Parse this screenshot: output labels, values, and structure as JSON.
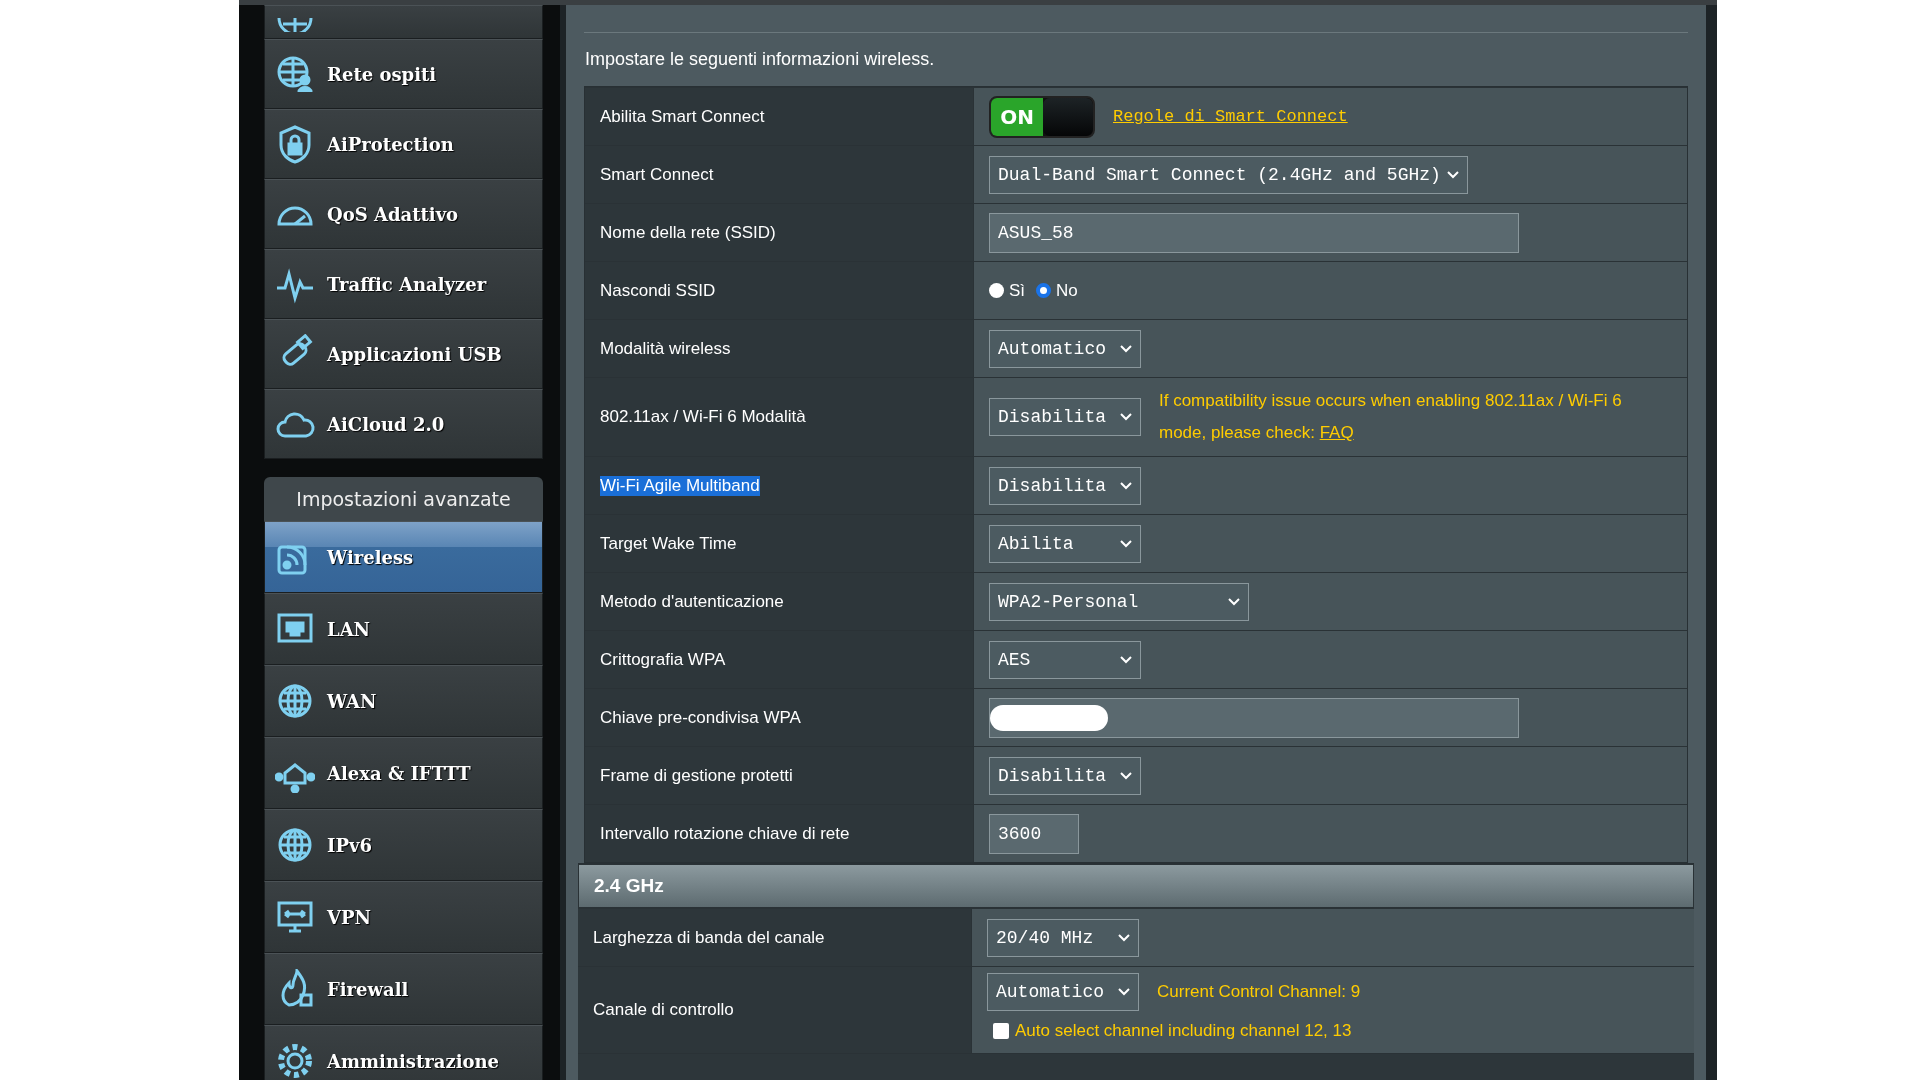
{
  "sidebar": {
    "items": [
      {
        "label": "Rete ospiti",
        "selected": false
      },
      {
        "label": "AiProtection",
        "selected": false
      },
      {
        "label": "QoS Adattivo",
        "selected": false
      },
      {
        "label": "Traffic Analyzer",
        "selected": false
      },
      {
        "label": "Applicazioni USB",
        "selected": false
      },
      {
        "label": "AiCloud 2.0",
        "selected": false
      }
    ],
    "advanced": {
      "title": "Impostazioni avanzate",
      "items": [
        {
          "label": "Wireless",
          "selected": true
        },
        {
          "label": "LAN",
          "selected": false
        },
        {
          "label": "WAN",
          "selected": false
        },
        {
          "label": "Alexa & IFTTT",
          "selected": false
        },
        {
          "label": "IPv6",
          "selected": false
        },
        {
          "label": "VPN",
          "selected": false
        },
        {
          "label": "Firewall",
          "selected": false
        },
        {
          "label": "Amministrazione",
          "selected": false
        }
      ]
    }
  },
  "main": {
    "intro": "Impostare le seguenti informazioni wireless.",
    "rows": [
      {
        "label": "Abilita Smart Connect",
        "kind": "toggle",
        "on": true,
        "toggle_text": "ON",
        "link": "Regole di Smart Connect"
      },
      {
        "label": "Smart Connect",
        "kind": "select",
        "value": "Dual-Band Smart Connect (2.4GHz and 5GHz)"
      },
      {
        "label": "Nome della rete (SSID)",
        "kind": "input",
        "value": "ASUS_58"
      },
      {
        "label": "Nascondi SSID",
        "kind": "radio",
        "options": [
          {
            "label": "Sì",
            "selected": false
          },
          {
            "label": "No",
            "selected": true
          }
        ]
      },
      {
        "label": "Modalità wireless",
        "kind": "select",
        "value": "Automatico"
      },
      {
        "label": "802.11ax / Wi-Fi 6 Modalità",
        "kind": "select",
        "value": "Disabilita",
        "note": "If compatibility issue occurs when enabling 802.11ax / Wi-Fi 6 mode, please check:",
        "note_link": "FAQ"
      },
      {
        "label": "Wi-Fi Agile Multiband",
        "kind": "select",
        "value": "Disabilita",
        "highlighted": true
      },
      {
        "label": "Target Wake Time",
        "kind": "select",
        "value": "Abilita"
      },
      {
        "label": "Metodo d'autenticazione",
        "kind": "select",
        "value": "WPA2-Personal"
      },
      {
        "label": "Crittografia WPA",
        "kind": "select",
        "value": "AES"
      },
      {
        "label": "Chiave pre-condivisa WPA",
        "kind": "input",
        "redacted": true
      },
      {
        "label": "Frame di gestione protetti",
        "kind": "select",
        "value": "Disabilita"
      },
      {
        "label": "Intervallo rotazione chiave di rete",
        "kind": "input",
        "value": "3600"
      }
    ],
    "sections": [
      {
        "title": "2.4 GHz",
        "rows": [
          {
            "label": "Larghezza di banda del canale",
            "kind": "select",
            "value": "20/40 MHz"
          },
          {
            "label": "Canale di controllo",
            "kind": "select",
            "value": "Automatico",
            "note": "Current Control Channel: 9",
            "checkbox": {
              "label": "Auto select channel including channel 12, 13",
              "checked": false
            }
          }
        ]
      }
    ]
  }
}
